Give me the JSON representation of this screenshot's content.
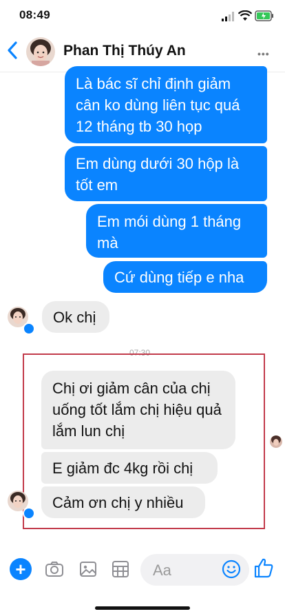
{
  "status_bar": {
    "time": "08:49"
  },
  "header": {
    "contact_name": "Phan Thị Thúy An"
  },
  "messages": [
    {
      "direction": "outgoing",
      "text": "Là bác sĩ chỉ định giảm cân ko dùng liên tục quá 12 tháng tb 30 họp"
    },
    {
      "direction": "outgoing",
      "text": "Em dùng dưới 30 hộp là tốt em"
    },
    {
      "direction": "outgoing",
      "text": "Em mói dùng 1 tháng mà"
    },
    {
      "direction": "outgoing",
      "text": "Cứ dùng tiếp e nha"
    },
    {
      "direction": "incoming",
      "text": "Ok chị"
    },
    {
      "direction": "incoming",
      "text": "Chị ơi giảm cân của chị uống tốt lắm chị hiệu quả lắm lun chị"
    },
    {
      "direction": "incoming",
      "text": "E giảm đc 4kg rồi chị"
    },
    {
      "direction": "incoming",
      "text": "Cảm ơn chị y nhiều"
    }
  ],
  "timestamp": "07:30",
  "composer": {
    "placeholder": "Aa"
  },
  "icons": [
    "back-chevron-icon",
    "more-icon",
    "plus-icon",
    "camera-icon",
    "photo-icon",
    "sticker-icon",
    "emoji-icon",
    "like-icon"
  ],
  "colors": {
    "outgoing_bubble": "#0a84ff",
    "incoming_bubble": "#ececec",
    "highlight_border": "#c23a4a"
  }
}
